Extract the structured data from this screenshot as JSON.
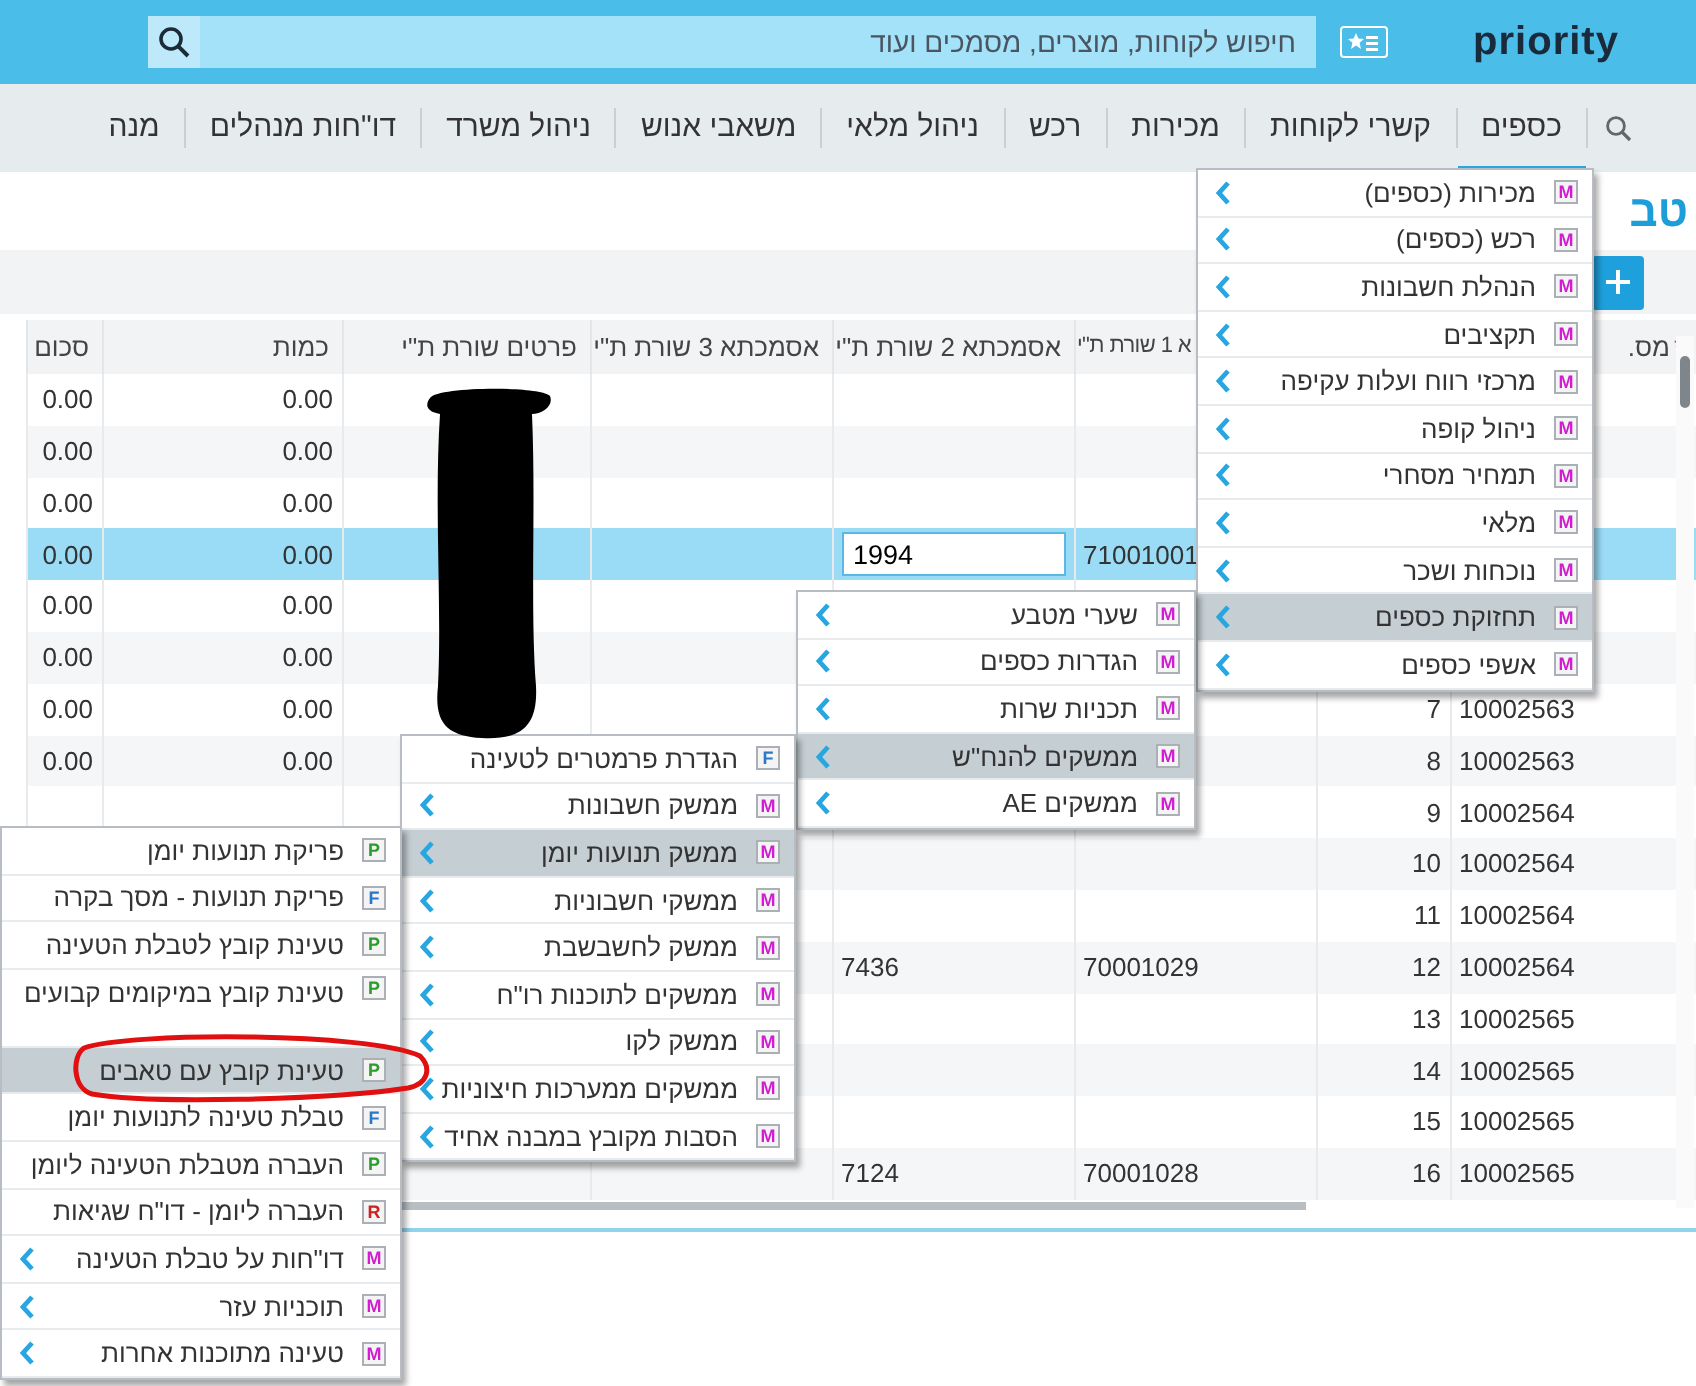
{
  "header": {
    "logo": "priority",
    "search": {
      "placeholder": "חיפוש לקוחות, מוצרים, מסמכים ועוד"
    }
  },
  "nav": [
    {
      "label": "כספים",
      "selected": true
    },
    {
      "label": "קשרי לקוחות",
      "selected": false
    },
    {
      "label": "מכירות",
      "selected": false
    },
    {
      "label": "רכש",
      "selected": false
    },
    {
      "label": "ניהול מלאי",
      "selected": false
    },
    {
      "label": "משאבי אנוש",
      "selected": false
    },
    {
      "label": "ניהול משרד",
      "selected": false
    },
    {
      "label": "דו\"חות מנהלים",
      "selected": false
    },
    {
      "label": "מנה",
      "selected": false
    }
  ],
  "title": "טב",
  "table": {
    "columns": [
      {
        "label": "מס.",
        "required": true
      },
      {},
      {
        "label": "א 1 שורת ת\"י"
      },
      {
        "label": "אסמכתא 2 שורת ת\"י"
      },
      {
        "label": "אסמכתא 3 שורת ת\"י"
      },
      {
        "label": "פרטים שורת ת\"י"
      },
      {
        "label": "כמות"
      },
      {
        "label": "סכום"
      }
    ],
    "rows": [
      {
        "selected": false,
        "cells": [
          null,
          null,
          null,
          null,
          null,
          null,
          "0.00",
          "0.00"
        ]
      },
      {
        "selected": false,
        "cells": [
          null,
          null,
          null,
          null,
          null,
          null,
          "0.00",
          "0.00"
        ]
      },
      {
        "selected": false,
        "cells": [
          null,
          null,
          null,
          null,
          null,
          null,
          "0.00",
          "0.00"
        ]
      },
      {
        "selected": true,
        "cells": [
          null,
          null,
          "71001001",
          {
            "value": "1994"
          },
          null,
          null,
          "0.00",
          "0.00"
        ]
      },
      {
        "selected": false,
        "cells": [
          null,
          null,
          null,
          null,
          null,
          null,
          "0.00",
          "0.00"
        ]
      },
      {
        "selected": false,
        "cells": [
          null,
          null,
          null,
          null,
          null,
          null,
          "0.00",
          "0.00"
        ]
      },
      {
        "selected": false,
        "cells": [
          "10002563",
          "7",
          null,
          null,
          null,
          null,
          "0.00",
          "0.00"
        ]
      },
      {
        "selected": false,
        "cells": [
          "10002563",
          "8",
          null,
          null,
          null,
          null,
          "0.00",
          "0.00"
        ]
      },
      {
        "selected": false,
        "cells": [
          "10002564",
          "9",
          null,
          null,
          null,
          null,
          null,
          null
        ]
      },
      {
        "selected": false,
        "cells": [
          "10002564",
          "10",
          null,
          null,
          null,
          null,
          null,
          null
        ]
      },
      {
        "selected": false,
        "cells": [
          "10002564",
          "11",
          null,
          null,
          null,
          null,
          null,
          null
        ]
      },
      {
        "selected": false,
        "cells": [
          "10002564",
          "12",
          "70001029",
          "7436",
          null,
          null,
          null,
          null
        ]
      },
      {
        "selected": false,
        "cells": [
          "10002565",
          "13",
          null,
          null,
          null,
          null,
          null,
          null
        ]
      },
      {
        "selected": false,
        "cells": [
          "10002565",
          "14",
          null,
          null,
          null,
          null,
          null,
          null
        ]
      },
      {
        "selected": false,
        "cells": [
          "10002565",
          "15",
          null,
          null,
          null,
          null,
          null,
          null
        ]
      },
      {
        "selected": false,
        "cells": [
          "10002565",
          "16",
          "70001028",
          "7124",
          null,
          null,
          null,
          null
        ]
      }
    ]
  },
  "menus": [
    {
      "items": [
        {
          "label": "מכירות (כספים)",
          "badge": "M",
          "kind": "menu",
          "selected": false
        },
        {
          "label": "רכש (כספים)",
          "badge": "M",
          "kind": "menu",
          "selected": false
        },
        {
          "label": "הנהלת חשבונות",
          "badge": "M",
          "kind": "menu",
          "selected": false
        },
        {
          "label": "תקציבים",
          "badge": "M",
          "kind": "menu",
          "selected": false
        },
        {
          "label": "מרכזי רווח ועלות עקיפה",
          "badge": "M",
          "kind": "menu",
          "selected": false
        },
        {
          "label": "ניהול קופה",
          "badge": "M",
          "kind": "menu",
          "selected": false
        },
        {
          "label": "תמחיר מסחרי",
          "badge": "M",
          "kind": "menu",
          "selected": false
        },
        {
          "label": "מלאי",
          "badge": "M",
          "kind": "menu",
          "selected": false
        },
        {
          "label": "נוכחות ושכר",
          "badge": "M",
          "kind": "menu",
          "selected": false
        },
        {
          "label": "תחזוקת כספים",
          "badge": "M",
          "kind": "menu",
          "selected": true
        },
        {
          "label": "אשפי כספים",
          "badge": "M",
          "kind": "menu",
          "selected": false
        }
      ]
    },
    {
      "items": [
        {
          "label": "שערי מטבע",
          "badge": "M",
          "kind": "menu",
          "selected": false
        },
        {
          "label": "הגדרות כספים",
          "badge": "M",
          "kind": "menu",
          "selected": false
        },
        {
          "label": "תכניות שרות",
          "badge": "M",
          "kind": "menu",
          "selected": false
        },
        {
          "label": "ממשקים להנח\"ש",
          "badge": "M",
          "kind": "menu",
          "selected": true
        },
        {
          "label": "ממשקים AE",
          "badge": "M",
          "kind": "menu",
          "selected": false
        }
      ]
    },
    {
      "items": [
        {
          "label": "הגדרת פרמטרים לטעינה",
          "badge": "F",
          "kind": "form",
          "selected": false
        },
        {
          "label": "ממשק חשבונות",
          "badge": "M",
          "kind": "menu",
          "selected": false
        },
        {
          "label": "ממשק תנועות יומן",
          "badge": "M",
          "kind": "menu",
          "selected": true
        },
        {
          "label": "ממשקי חשבוניות",
          "badge": "M",
          "kind": "menu",
          "selected": false
        },
        {
          "label": "ממשק לחשבשבת",
          "badge": "M",
          "kind": "menu",
          "selected": false
        },
        {
          "label": "ממשקים לתוכנות רו\"ח",
          "badge": "M",
          "kind": "menu",
          "selected": false
        },
        {
          "label": "ממשק לקו",
          "badge": "M",
          "kind": "menu",
          "selected": false
        },
        {
          "label": "ממשקים ממערכות חיצוניות",
          "badge": "M",
          "kind": "menu",
          "selected": false
        },
        {
          "label": "הסבות מקובץ במבנה אחיד",
          "badge": "M",
          "kind": "menu",
          "selected": false
        }
      ]
    },
    {
      "items": [
        {
          "label": "פריקת תנועות יומן",
          "badge": "P",
          "kind": "procedure",
          "selected": false
        },
        {
          "label": "פריקת תנועות - מסך בקרה",
          "badge": "F",
          "kind": "form",
          "selected": false
        },
        {
          "label": "טעינת קובץ לטבלת הטעינה",
          "badge": "P",
          "kind": "procedure",
          "selected": false
        },
        {
          "label": "טעינת קובץ במיקומים קבועים",
          "badge": "P",
          "kind": "procedure",
          "selected": false
        },
        {
          "label": "טעינת קובץ עם טאבים",
          "badge": "P",
          "kind": "procedure",
          "selected": true
        },
        {
          "label": "טבלת טעינה לתנועות יומן",
          "badge": "F",
          "kind": "form",
          "selected": false
        },
        {
          "label": "העברה מטבלת הטעינה ליומן",
          "badge": "P",
          "kind": "procedure",
          "selected": false
        },
        {
          "label": "העברה ליומן - דו\"ח שגיאות",
          "badge": "R",
          "kind": "report",
          "selected": false
        },
        {
          "label": "דו\"חות על טבלת הטעינה",
          "badge": "M",
          "kind": "menu",
          "selected": false
        },
        {
          "label": "תוכניות עזר",
          "badge": "M",
          "kind": "menu",
          "selected": false
        },
        {
          "label": "טעינה מתוכנות אחרות",
          "badge": "M",
          "kind": "menu",
          "selected": false
        }
      ]
    }
  ]
}
